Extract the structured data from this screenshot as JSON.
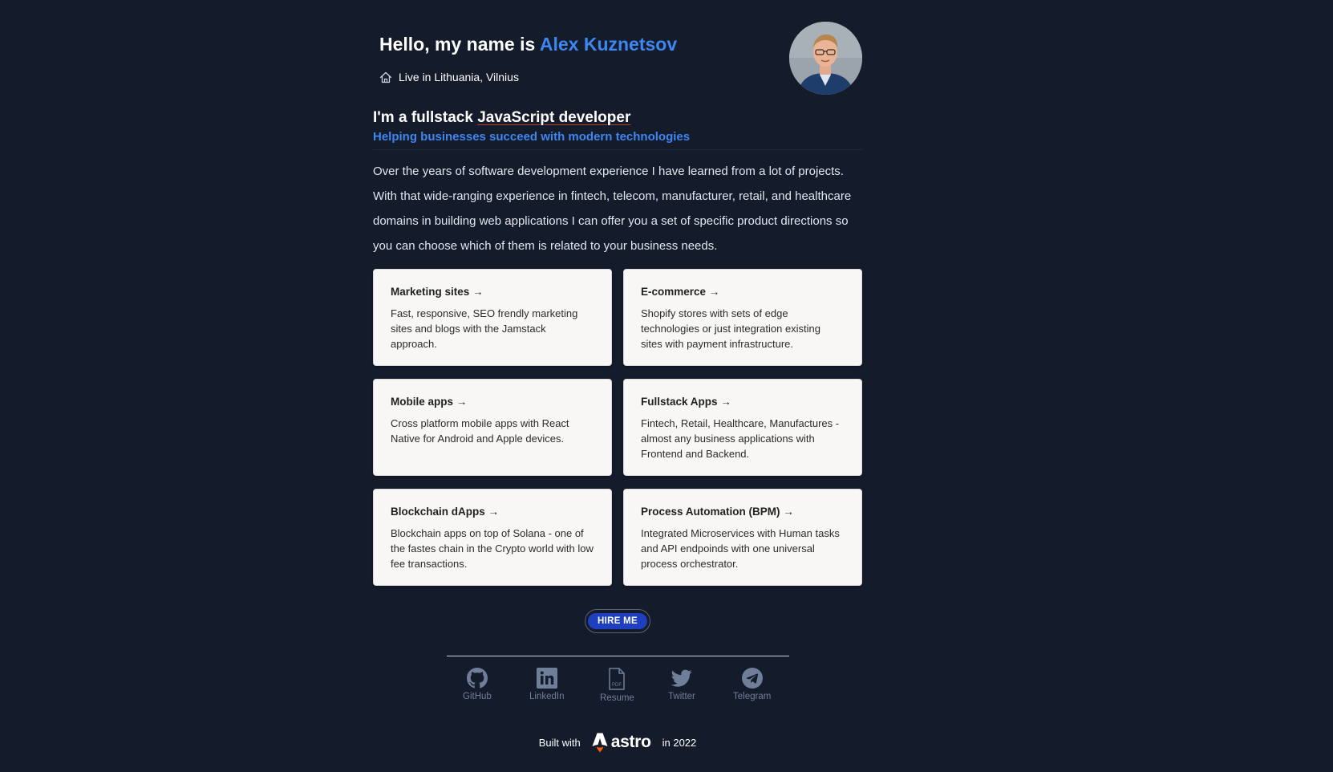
{
  "header": {
    "greeting": "Hello, my name is",
    "name": "Alex Kuznetsov",
    "location_icon": "home-icon",
    "location": "Live in Lithuania, Vilnius"
  },
  "headline": {
    "prefix": "I'm a fullstack",
    "emphasis": "JavaScript developer",
    "subheadline": "Helping businesses succeed with modern technologies"
  },
  "intro": "Over the years of software development experience I have learned from a lot of projects. With that wide-ranging experience in fintech, telecom, manufacturer, retail, and healthcare domains in building web applications I can offer you a set of specific product directions so you can choose which of them is related to your business needs.",
  "services": [
    {
      "title": "Marketing sites →",
      "description": "Fast, responsive, SEO frendly marketing sites and blogs with the Jamstack approach."
    },
    {
      "title": "E-commerce →",
      "description": "Shopify stores with sets of edge technologies or just integration existing sites with payment infrastructure."
    },
    {
      "title": "Mobile apps →",
      "description": "Cross platform mobile apps with React Native for Android and Apple devices."
    },
    {
      "title": "Fullstack Apps →",
      "description": "Fintech, Retail, Healthcare, Manufactures - almost any business applications with Frontend and Backend."
    },
    {
      "title": "Blockchain dApps →",
      "description": "Blockchain apps on top of Solana - one of the fastes chain in the Crypto world with low fee transactions."
    },
    {
      "title": "Process Automation (BPM) →",
      "description": "Integrated Microservices with Human tasks and API endpoinds with one universal process orchestrator."
    }
  ],
  "cta": {
    "hire_label": "HIRE ME"
  },
  "socials": [
    {
      "label": "GitHub",
      "icon": "github-icon"
    },
    {
      "label": "LinkedIn",
      "icon": "linkedin-icon"
    },
    {
      "label": "Resume",
      "icon": "pdf-icon"
    },
    {
      "label": "Twitter",
      "icon": "twitter-icon"
    },
    {
      "label": "Telegram",
      "icon": "telegram-icon"
    }
  ],
  "footer": {
    "built_with": "Built with",
    "brand": "astro",
    "year_text": "in 2022"
  },
  "colors": {
    "background": "#141b2b",
    "accent": "#3e86f0",
    "button": "#1f3fbf",
    "card": "#f8f7f5",
    "social_icon": "#6f7f99"
  }
}
